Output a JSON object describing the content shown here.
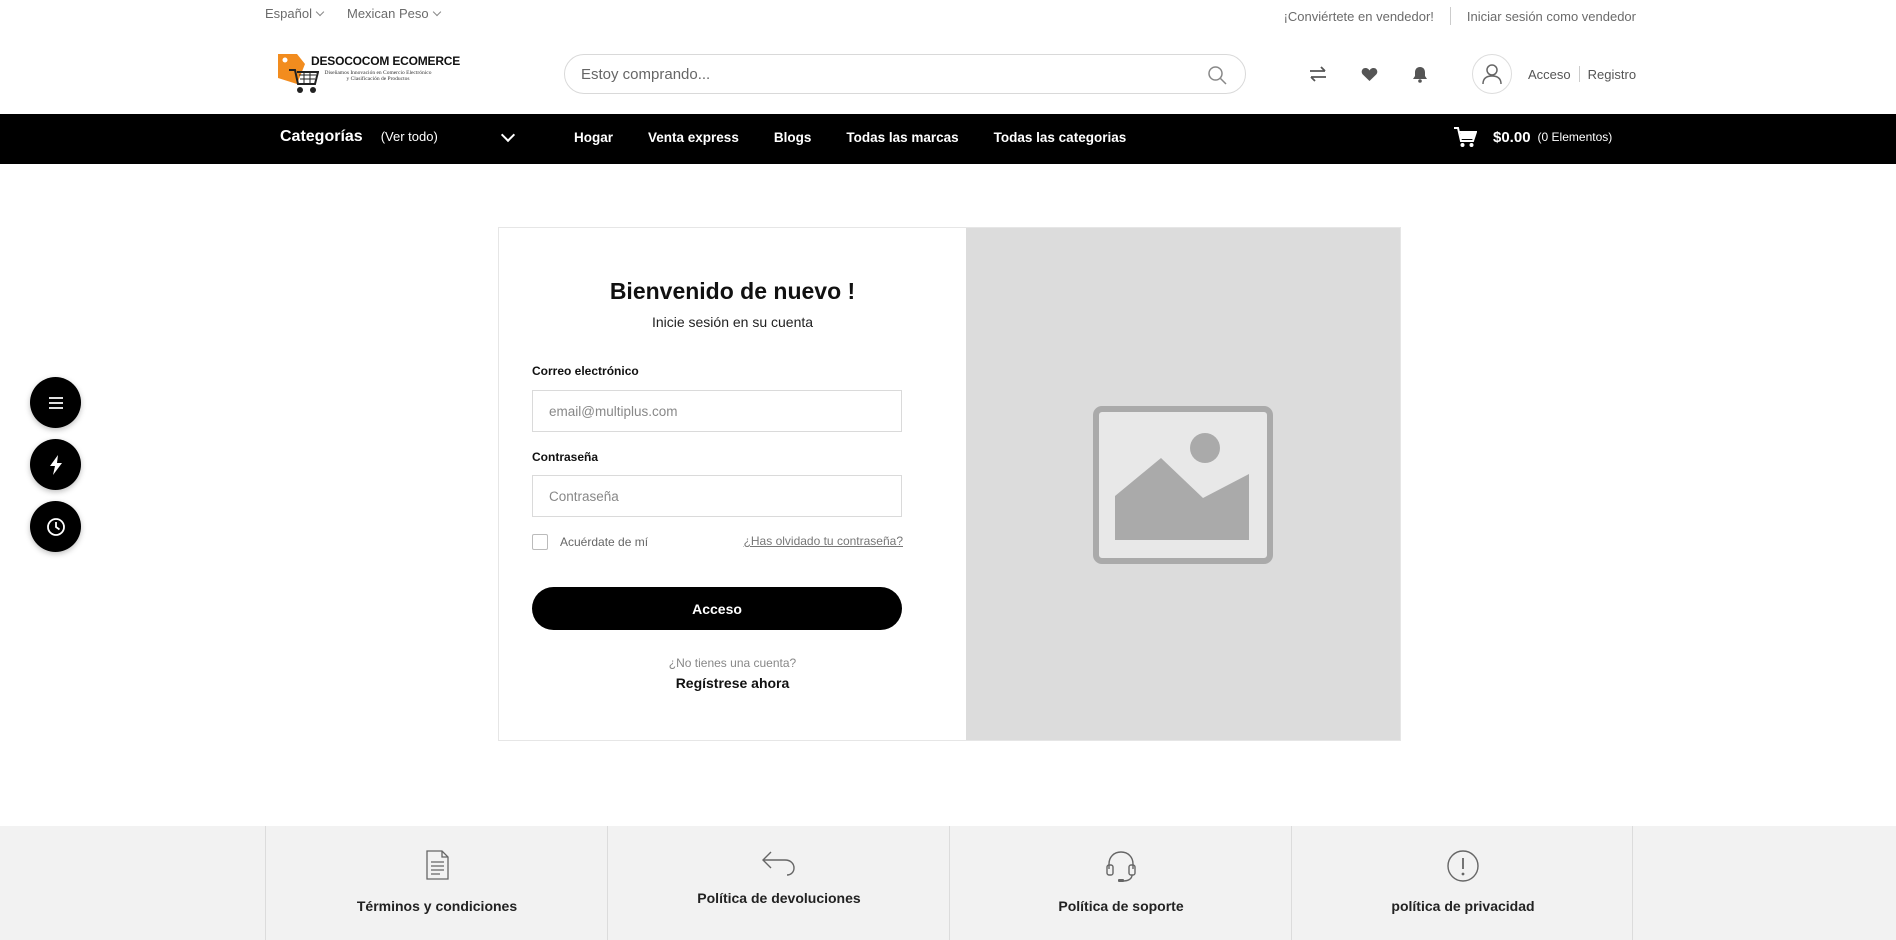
{
  "topbar": {
    "language": "Español",
    "currency": "Mexican Peso",
    "become_seller": "¡Conviértete en vendedor!",
    "seller_login": "Iniciar sesión como vendedor"
  },
  "header": {
    "logo_title": "DESOCOCOM ECOMERCE",
    "logo_subtitle": "Diseñamos Innovación en Comercio Electrónico y Clasificación de Productos",
    "search_placeholder": "Estoy comprando...",
    "login": "Acceso",
    "register": "Registro"
  },
  "nav": {
    "categories": "Categorías",
    "view_all": "(Ver todo)",
    "links": [
      "Hogar",
      "Venta express",
      "Blogs",
      "Todas las marcas",
      "Todas las categorias"
    ],
    "cart_amount": "$0.00",
    "cart_count": "(0 Elementos)"
  },
  "login": {
    "title": "Bienvenido de nuevo !",
    "subtitle": "Inicie sesión en su cuenta",
    "email_label": "Correo electrónico",
    "email_placeholder": "email@multiplus.com",
    "password_label": "Contraseña",
    "password_placeholder": "Contraseña",
    "remember": "Acuérdate de mí",
    "forgot": "¿Has olvidado tu contraseña?",
    "submit": "Acceso",
    "no_account": "¿No tienes una cuenta?",
    "register_now": "Regístrese ahora"
  },
  "footer": {
    "policies": [
      "Términos y condiciones",
      "Política de devoluciones",
      "Política de soporte",
      "política de privacidad"
    ]
  },
  "icons": {
    "fab": [
      "menu-icon",
      "flash-icon",
      "clock-icon"
    ],
    "header": [
      "compare-icon",
      "heart-icon",
      "bell-icon",
      "user-icon"
    ]
  },
  "colors": {
    "nav_bg": "#000000",
    "accent_logo": "#f28c1e",
    "image_placeholder": "#dcdcdc",
    "footer_bg": "#f2f2f2"
  }
}
